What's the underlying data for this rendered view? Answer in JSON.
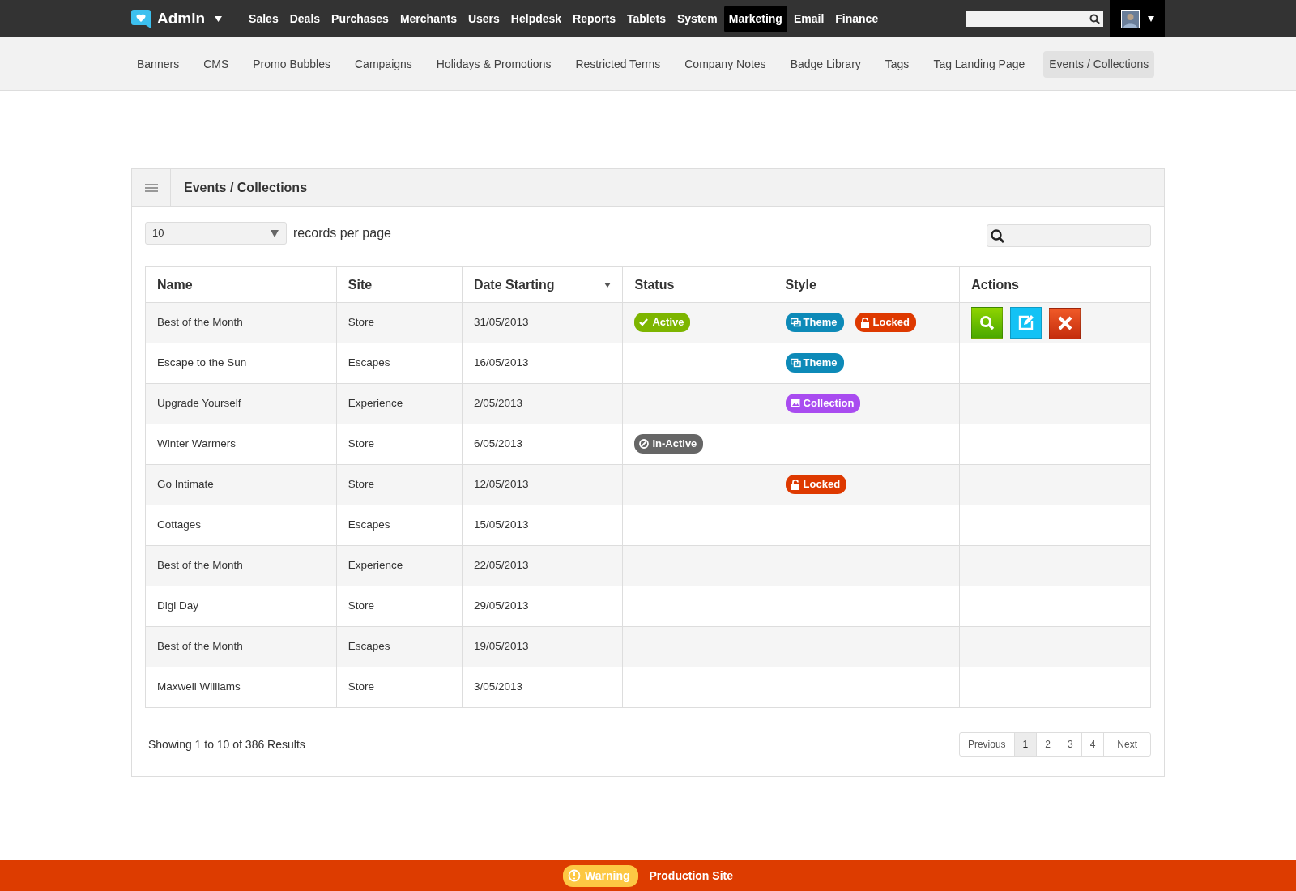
{
  "topbar": {
    "brand": "Admin",
    "nav": [
      {
        "label": "Sales",
        "selected": false
      },
      {
        "label": "Deals",
        "selected": false
      },
      {
        "label": "Purchases",
        "selected": false
      },
      {
        "label": "Merchants",
        "selected": false
      },
      {
        "label": "Users",
        "selected": false
      },
      {
        "label": "Helpdesk",
        "selected": false
      },
      {
        "label": "Reports",
        "selected": false
      },
      {
        "label": "Tablets",
        "selected": false
      },
      {
        "label": "System",
        "selected": false
      },
      {
        "label": "Marketing",
        "selected": true
      },
      {
        "label": "Email",
        "selected": false
      },
      {
        "label": "Finance",
        "selected": false
      }
    ]
  },
  "subnav": [
    {
      "label": "Banners",
      "selected": false
    },
    {
      "label": "CMS",
      "selected": false
    },
    {
      "label": "Promo Bubbles",
      "selected": false
    },
    {
      "label": "Campaigns",
      "selected": false
    },
    {
      "label": "Holidays & Promotions",
      "selected": false
    },
    {
      "label": "Restricted Terms",
      "selected": false
    },
    {
      "label": "Company Notes",
      "selected": false
    },
    {
      "label": "Badge Library",
      "selected": false
    },
    {
      "label": "Tags",
      "selected": false
    },
    {
      "label": "Tag Landing Page",
      "selected": false
    },
    {
      "label": "Events / Collections",
      "selected": true
    }
  ],
  "panel": {
    "title": "Events / Collections",
    "page_size": "10",
    "page_size_label": "records per page",
    "table": {
      "columns": [
        {
          "label": "Name",
          "sorted": false
        },
        {
          "label": "Site",
          "sorted": false
        },
        {
          "label": "Date Starting",
          "sorted": true
        },
        {
          "label": "Status",
          "sorted": false
        },
        {
          "label": "Style",
          "sorted": false
        },
        {
          "label": "Actions",
          "sorted": false
        }
      ],
      "rows": [
        {
          "name": "Best of the Month",
          "site": "Store",
          "date": "31/05/2013",
          "status": {
            "kind": "active",
            "label": "Active"
          },
          "styles": [
            {
              "kind": "theme",
              "label": "Theme"
            },
            {
              "kind": "locked",
              "label": "Locked"
            }
          ],
          "actions": true
        },
        {
          "name": "Escape to the Sun",
          "site": "Escapes",
          "date": "16/05/2013",
          "styles": [
            {
              "kind": "theme",
              "label": "Theme"
            }
          ],
          "actions": false
        },
        {
          "name": "Upgrade Yourself",
          "site": "Experience",
          "date": "2/05/2013",
          "styles": [
            {
              "kind": "collection",
              "label": "Collection"
            }
          ],
          "actions": false
        },
        {
          "name": "Winter Warmers",
          "site": "Store",
          "date": "6/05/2013",
          "status": {
            "kind": "inactive",
            "label": "In-Active"
          },
          "styles": [],
          "actions": false
        },
        {
          "name": "Go Intimate",
          "site": "Store",
          "date": "12/05/2013",
          "styles": [
            {
              "kind": "locked",
              "label": "Locked"
            }
          ],
          "actions": false
        },
        {
          "name": "Cottages",
          "site": "Escapes",
          "date": "15/05/2013",
          "styles": [],
          "actions": false
        },
        {
          "name": "Best of the Month",
          "site": "Experience",
          "date": "22/05/2013",
          "styles": [],
          "actions": false
        },
        {
          "name": "Digi Day",
          "site": "Store",
          "date": "29/05/2013",
          "styles": [],
          "actions": false
        },
        {
          "name": "Best of the Month",
          "site": "Escapes",
          "date": "19/05/2013",
          "styles": [],
          "actions": false
        },
        {
          "name": "Maxwell Williams",
          "site": "Store",
          "date": "3/05/2013",
          "styles": [],
          "actions": false
        }
      ]
    },
    "summary": "Showing 1 to 10 of 386 Results",
    "pagination": {
      "previous": "Previous",
      "next": "Next",
      "pages": [
        {
          "label": "1",
          "selected": true
        },
        {
          "label": "2",
          "selected": false
        },
        {
          "label": "3",
          "selected": false
        },
        {
          "label": "4",
          "selected": false
        }
      ]
    }
  },
  "footer": {
    "badge": "Warning",
    "text": "Production Site"
  }
}
